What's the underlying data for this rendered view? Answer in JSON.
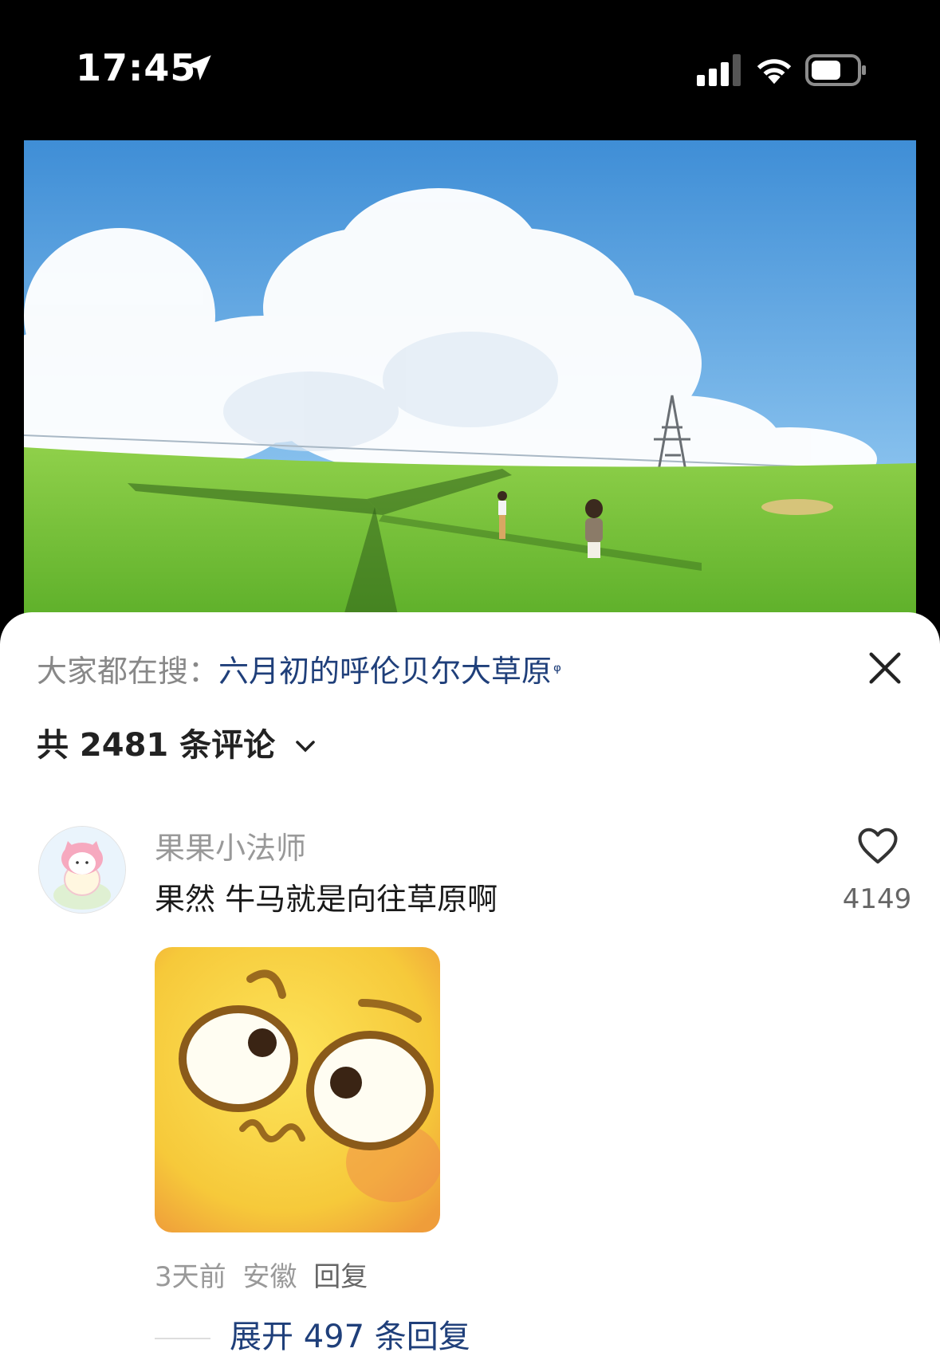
{
  "status_bar": {
    "time": "17:45",
    "icons": [
      "location-arrow-icon",
      "cellular-signal-icon",
      "wifi-icon",
      "battery-icon"
    ]
  },
  "video": {
    "description_icon": "video-thumbnail"
  },
  "comments_panel": {
    "search_prefix": "大家都在搜：",
    "search_term": "六月初的呼伦贝尔大草原",
    "search_icon": "ᵠ",
    "comment_count_label": "共 2481 条评论",
    "close_icon": "close-icon"
  },
  "comment": {
    "username": "果果小法师",
    "text": "果然 牛马就是向往草原啊",
    "like_count": "4149",
    "time": "3天前",
    "location": "安徽",
    "reply_label": "回复",
    "expand_label": "展开 497 条回复"
  },
  "colors": {
    "accent_link": "#1f3f7a",
    "muted_text": "#999999",
    "sky": "#5aa8e0",
    "grass": "#7ec73a"
  }
}
